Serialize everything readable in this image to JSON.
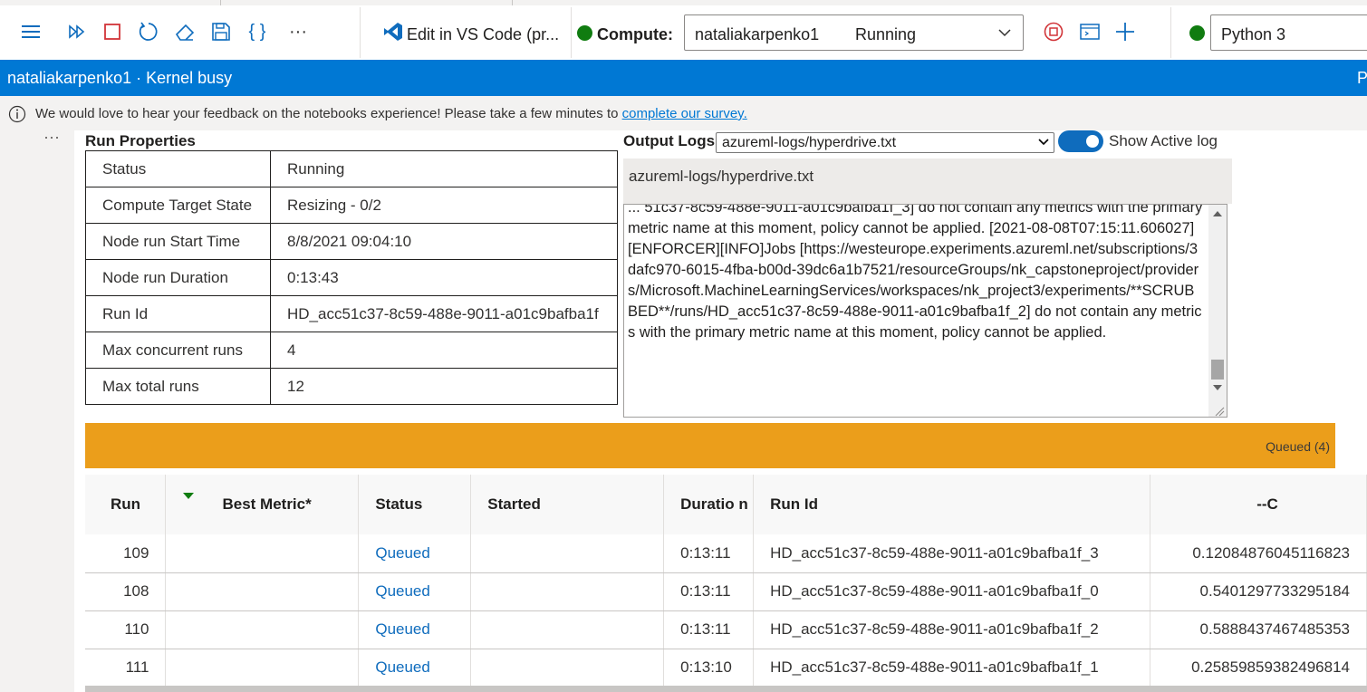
{
  "toolbar": {
    "edit_vscode": "Edit in VS Code (pr...",
    "compute_label": "Compute:",
    "compute_name": "nataliakarpenko1",
    "compute_status": "Running",
    "kernel_name": "Python 3",
    "more_icon": "···"
  },
  "statusbar": {
    "text": "nataliakarpenko1 · Kernel busy",
    "right_text": "P"
  },
  "feedback": {
    "text": "We would love to hear your feedback on the notebooks experience! Please take a few minutes to",
    "link": "complete our survey."
  },
  "cell": {
    "more": "···"
  },
  "run_properties": {
    "title": "Run Properties",
    "rows": [
      {
        "key": "Status",
        "value": "Running"
      },
      {
        "key": "Compute Target State",
        "value": "Resizing - 0/2"
      },
      {
        "key": "Node run Start Time",
        "value": "8/8/2021 09:04:10"
      },
      {
        "key": "Node run Duration",
        "value": "0:13:43"
      },
      {
        "key": "Run Id",
        "value": "HD_acc51c37-8c59-488e-9011-a01c9bafba1f"
      },
      {
        "key": "Max concurrent runs",
        "value": "4"
      },
      {
        "key": "Max total runs",
        "value": "12"
      }
    ]
  },
  "output_logs": {
    "title": "Output Logs",
    "selected_file": "azureml-logs/hyperdrive.txt",
    "toggle_label": "Show Active log",
    "toggle_on": true,
    "header": "azureml-logs/hyperdrive.txt",
    "text": "... 51c37-8c59-488e-9011-a01c9bafba1f_3] do not contain any metrics with the primary metric name at this moment, policy cannot be applied. [2021-08-08T07:15:11.606027][ENFORCER][INFO]Jobs [https://westeurope.experiments.azureml.net/subscriptions/3dafc970-6015-4fba-b00d-39dc6a1b7521/resourceGroups/nk_capstoneproject/providers/Microsoft.MachineLearningServices/workspaces/nk_project3/experiments/**SCRUBBED**/runs/HD_acc51c37-8c59-488e-9011-a01c9bafba1f_2] do not contain any metrics with the primary metric name at this moment, policy cannot be applied."
  },
  "queued_bar": {
    "label": "Queued (4)"
  },
  "runs_table": {
    "headers": [
      "Run",
      "Best Metric*",
      "Status",
      "Started",
      "Duratio n",
      "Run Id",
      "--C"
    ],
    "rows": [
      {
        "run": "109",
        "best": "",
        "status": "Queued",
        "started": "",
        "duration": "0:13:11",
        "run_id": "HD_acc51c37-8c59-488e-9011-a01c9bafba1f_3",
        "c": "0.12084876045116823"
      },
      {
        "run": "108",
        "best": "",
        "status": "Queued",
        "started": "",
        "duration": "0:13:11",
        "run_id": "HD_acc51c37-8c59-488e-9011-a01c9bafba1f_0",
        "c": "0.5401297733295184"
      },
      {
        "run": "110",
        "best": "",
        "status": "Queued",
        "started": "",
        "duration": "0:13:11",
        "run_id": "HD_acc51c37-8c59-488e-9011-a01c9bafba1f_2",
        "c": "0.5888437467485353"
      },
      {
        "run": "111",
        "best": "",
        "status": "Queued",
        "started": "",
        "duration": "0:13:10",
        "run_id": "HD_acc51c37-8c59-488e-9011-a01c9bafba1f_1",
        "c": "0.25859859382496814"
      }
    ]
  },
  "colors": {
    "accent": "#0078d4",
    "queued": "#eb9e1b",
    "running_dot": "#107c10"
  }
}
